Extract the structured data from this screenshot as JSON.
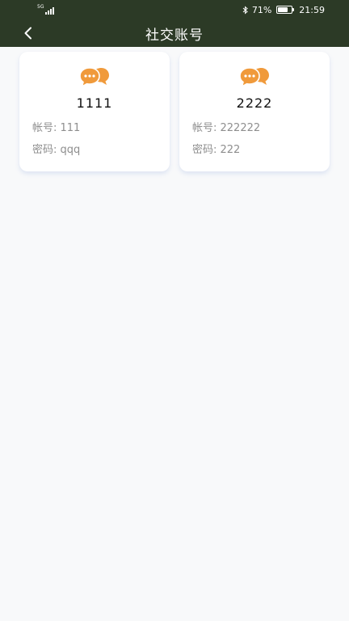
{
  "status_bar": {
    "network": "5G",
    "bluetooth_icon": "bluetooth-icon",
    "battery_percent": "71%",
    "battery_level": 0.71,
    "time": "21:59"
  },
  "header": {
    "title": "社交账号",
    "back_icon": "chevron-left-icon"
  },
  "accounts": [
    {
      "name": "1111",
      "account_label": "帐号: 111",
      "password_label": "密码: qqq"
    },
    {
      "name": "2222",
      "account_label": "帐号: 222222",
      "password_label": "密码: 222"
    }
  ],
  "colors": {
    "header_bg": "#2c3a26",
    "icon_orange": "#f09a3b",
    "page_bg": "#f8f9fa"
  }
}
